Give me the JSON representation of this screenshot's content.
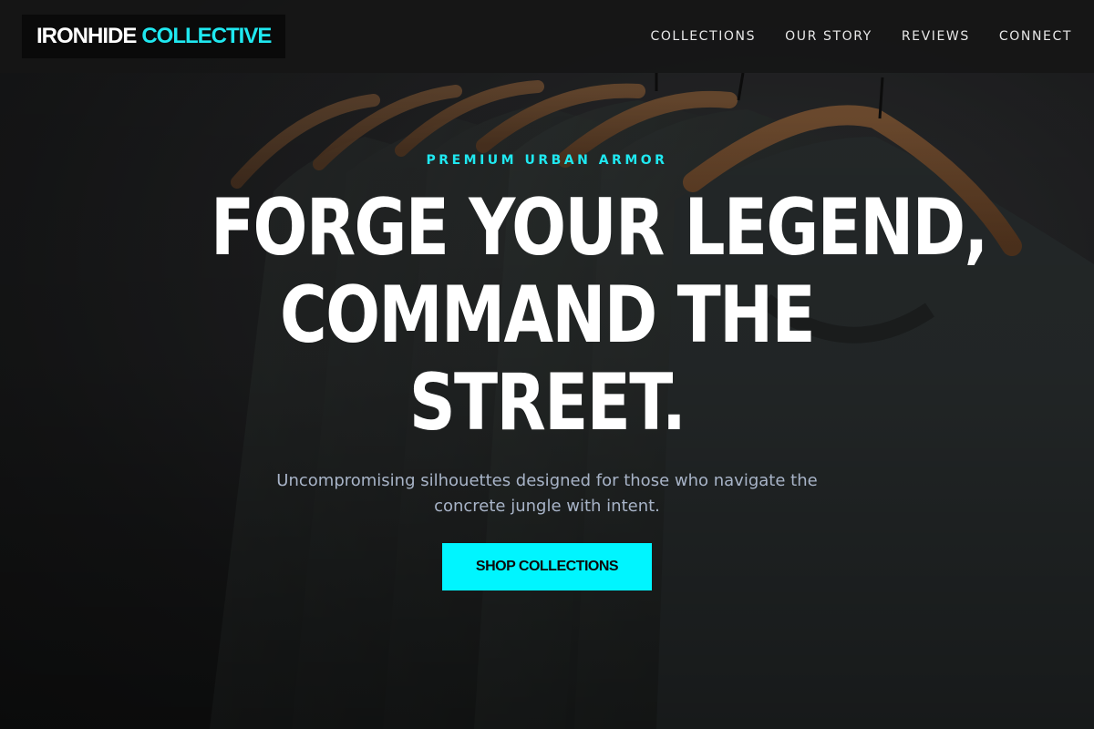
{
  "brand": {
    "name_part1": "IRONHIDE",
    "name_part2": "COLLECTIVE",
    "accent_color": "#1fe8f0"
  },
  "nav": {
    "items": [
      {
        "label": "COLLECTIONS"
      },
      {
        "label": "OUR STORY"
      },
      {
        "label": "REVIEWS"
      },
      {
        "label": "CONNECT"
      }
    ]
  },
  "hero": {
    "eyebrow": "PREMIUM URBAN ARMOR",
    "headline_lines": [
      "FORGE YOUR LEGEND,",
      "COMMAND THE",
      "STREET."
    ],
    "subtitle_line1": "Uncompromising silhouettes designed for those who navigate the",
    "subtitle_line2": "concrete jungle with intent.",
    "cta_label": "SHOP COLLECTIONS",
    "cta_color": "#00f5ff",
    "background_image": "dark t-shirts on wooden hangers"
  }
}
